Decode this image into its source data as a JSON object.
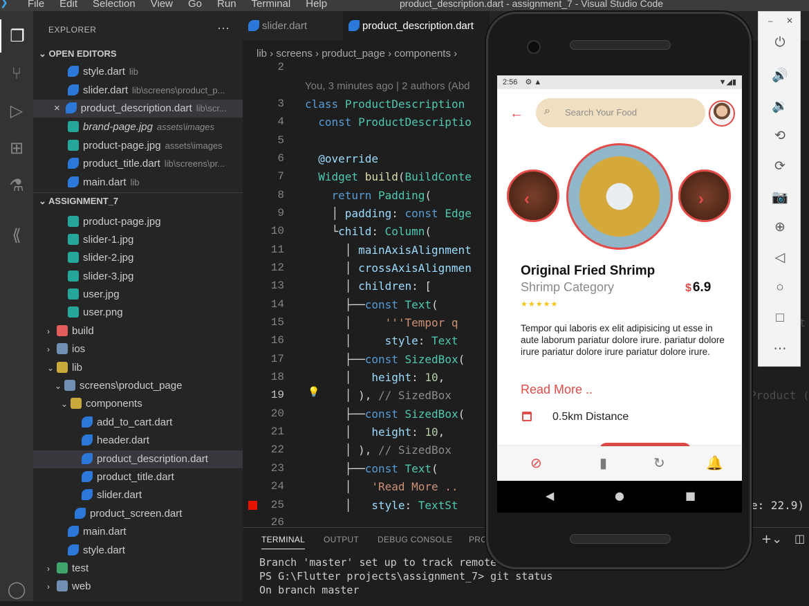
{
  "app": {
    "menu": [
      "File",
      "Edit",
      "Selection",
      "View",
      "Go",
      "Run",
      "Terminal",
      "Help"
    ],
    "window_title": "product_description.dart - assignment_7 - Visual Studio Code"
  },
  "activity": [
    "files-icon",
    "source-control-icon",
    "run-debug-icon",
    "extensions-icon",
    "testing-icon",
    "flutter-icon",
    "account-icon"
  ],
  "sidebar": {
    "header": "EXPLORER",
    "more": "···",
    "open_editors_title": "OPEN EDITORS",
    "open_editors": [
      {
        "name": "style.dart",
        "path": "lib",
        "type": "dart"
      },
      {
        "name": "slider.dart",
        "path": "lib\\screens\\product_p...",
        "type": "dart"
      },
      {
        "name": "product_description.dart",
        "path": "lib\\scr...",
        "type": "dart",
        "close": "×"
      },
      {
        "name": "brand-page.jpg",
        "path": "assets\\images",
        "type": "img"
      },
      {
        "name": "product-page.jpg",
        "path": "assets\\images",
        "type": "img"
      },
      {
        "name": "product_title.dart",
        "path": "lib\\screens\\pr...",
        "type": "dart"
      },
      {
        "name": "main.dart",
        "path": "lib",
        "type": "dart"
      }
    ],
    "project_title": "ASSIGNMENT_7",
    "tree": [
      {
        "name": "product-page.jpg",
        "type": "img",
        "indent": 1
      },
      {
        "name": "slider-1.jpg",
        "type": "img",
        "indent": 1
      },
      {
        "name": "slider-2.jpg",
        "type": "img",
        "indent": 1
      },
      {
        "name": "slider-3.jpg",
        "type": "img",
        "indent": 1
      },
      {
        "name": "user.jpg",
        "type": "img",
        "indent": 1
      },
      {
        "name": "user.png",
        "type": "img",
        "indent": 1
      },
      {
        "name": "build",
        "type": "foldr",
        "indent": 0,
        "chev": "›"
      },
      {
        "name": "ios",
        "type": "foldb",
        "indent": 0,
        "chev": "›"
      },
      {
        "name": "lib",
        "type": "fold",
        "indent": 0,
        "chev": "⌄"
      },
      {
        "name": "screens\\product_page",
        "type": "fold",
        "indent": 1,
        "chev": "⌄"
      },
      {
        "name": "components",
        "type": "fold",
        "indent": 2,
        "chev": "⌄"
      },
      {
        "name": "add_to_cart.dart",
        "type": "dart",
        "indent": 3
      },
      {
        "name": "header.dart",
        "type": "dart",
        "indent": 3
      },
      {
        "name": "product_description.dart",
        "type": "dart",
        "indent": 3,
        "selected": true
      },
      {
        "name": "product_title.dart",
        "type": "dart",
        "indent": 3
      },
      {
        "name": "slider.dart",
        "type": "dart",
        "indent": 3
      },
      {
        "name": "product_screen.dart",
        "type": "dart",
        "indent": 2
      },
      {
        "name": "main.dart",
        "type": "dart",
        "indent": 1
      },
      {
        "name": "style.dart",
        "type": "dart",
        "indent": 1
      },
      {
        "name": "test",
        "type": "foldg",
        "indent": 0,
        "chev": "›"
      },
      {
        "name": "web",
        "type": "foldb",
        "indent": 0,
        "chev": "›"
      }
    ]
  },
  "tabs": [
    {
      "label": "slider.dart",
      "active": false
    },
    {
      "label": "product_description.dart",
      "active": true
    }
  ],
  "breadcrumb": "lib › screens › product_page › components ›",
  "editor": {
    "blame": "You, 3 minutes ago | 2 authors (Abd",
    "ghost_19": "Product (",
    "ghost_25": "e: 22.9)",
    "ghost_15": "s",
    "ghost_15b": "ut"
  },
  "panel": {
    "tabs": [
      "TERMINAL",
      "OUTPUT",
      "DEBUG CONSOLE",
      "PRO"
    ],
    "lines": [
      "Branch 'master' set up to track remote",
      "PS G:\\Flutter projects\\assignment_7> git status",
      "On branch master"
    ]
  },
  "phone": {
    "time": "2:56",
    "search_placeholder": "Search Your Food",
    "product_title": "Original Fried Shrimp",
    "category": "Shrimp Category",
    "currency": "$",
    "price": "6.9",
    "rating_stars": "★★★★★",
    "rating": 5,
    "description": "Tempor qui laboris ex elit adipisicing ut esse in aute laborum pariatur dolore irure. pariatur dolore irure pariatur dolore irure pariatur dolore irure.",
    "read_more": "Read More ..",
    "distance": "0.5km Distance",
    "accent": "#e24b47"
  },
  "emulator_toolbar": [
    "power-icon",
    "volume-up-icon",
    "volume-down-icon",
    "rotate-left-icon",
    "rotate-right-icon",
    "camera-icon",
    "zoom-icon",
    "back-icon",
    "home-icon",
    "overview-icon",
    "more-icon"
  ]
}
